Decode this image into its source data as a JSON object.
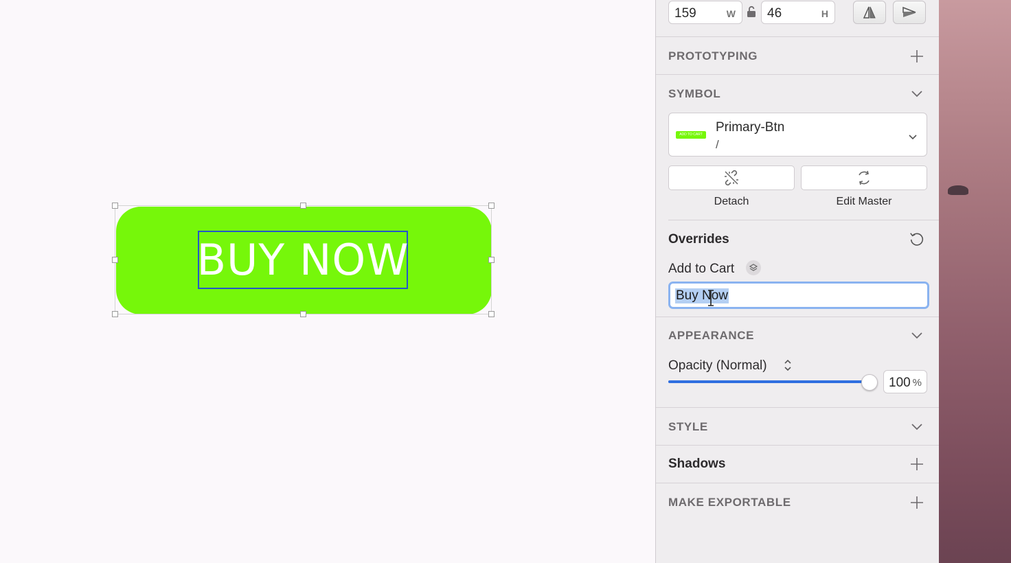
{
  "canvas": {
    "button_text": "BUY NOW",
    "button_color": "#76f70a",
    "selection_color": "#2457c9"
  },
  "inspector": {
    "size": {
      "width_value": "159",
      "width_suffix": "W",
      "height_value": "46",
      "height_suffix": "H",
      "lock_icon": "lock-open-icon",
      "flip_horizontal_icon": "flip-horizontal-icon",
      "flip_vertical_icon": "flip-vertical-icon"
    },
    "prototyping": {
      "title": "PROTOTYPING",
      "icon": "plus-icon"
    },
    "symbol": {
      "title": "SYMBOL",
      "name": "Primary-Btn",
      "path": "/",
      "thumbnail_text": "ADD TO CART",
      "detach_label": "Detach",
      "edit_master_label": "Edit Master"
    },
    "overrides": {
      "title": "Overrides",
      "reset_icon": "reset-icon",
      "layer_name": "Add to Cart",
      "layer_icon": "layers-icon",
      "value": "Buy Now"
    },
    "appearance": {
      "title": "APPEARANCE",
      "blend_label": "Opacity (Normal)",
      "opacity": 1.0,
      "opacity_value": "100",
      "opacity_suffix": "%"
    },
    "style": {
      "title": "STYLE"
    },
    "shadows": {
      "title": "Shadows"
    },
    "make_exportable": {
      "title": "MAKE EXPORTABLE"
    }
  }
}
